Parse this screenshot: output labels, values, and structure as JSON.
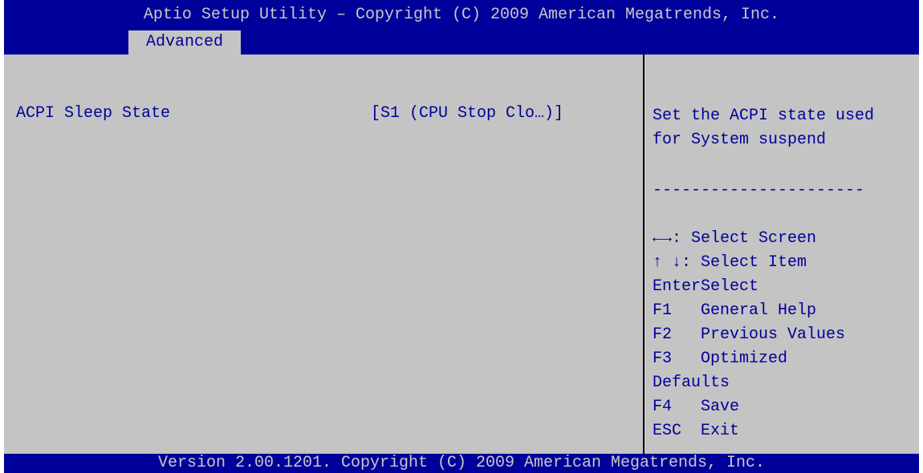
{
  "title": "Aptio Setup Utility – Copyright (C) 2009 American Megatrends, Inc.",
  "active_tab": "Advanced",
  "option": {
    "label": "ACPI Sleep State",
    "value": "[S1 (CPU Stop Clo…)]"
  },
  "help": {
    "line1": "Set the ACPI state used",
    "line2": "for System suspend"
  },
  "separator": "----------------------",
  "keys": [
    {
      "key": "←→",
      "desc": ": Select Screen"
    },
    {
      "key": "↑ ↓",
      "desc": ": Select Item"
    },
    {
      "key": "Enter",
      "desc": "Select"
    },
    {
      "key": "F1",
      "desc": "General Help"
    },
    {
      "key": "F2",
      "desc": "Previous Values"
    },
    {
      "key": "F3",
      "desc": "Optimized"
    },
    {
      "key": "",
      "desc": "Defaults"
    },
    {
      "key": "F4",
      "desc": "Save"
    },
    {
      "key": "ESC",
      "desc": "Exit"
    }
  ],
  "footer": "Version 2.00.1201. Copyright (C) 2009 American Megatrends, Inc.",
  "colors": {
    "header_blue": "#00009a",
    "panel_gray": "#c4c4c4",
    "header_text": "#c8c8c8",
    "body_text": "#00009a"
  }
}
